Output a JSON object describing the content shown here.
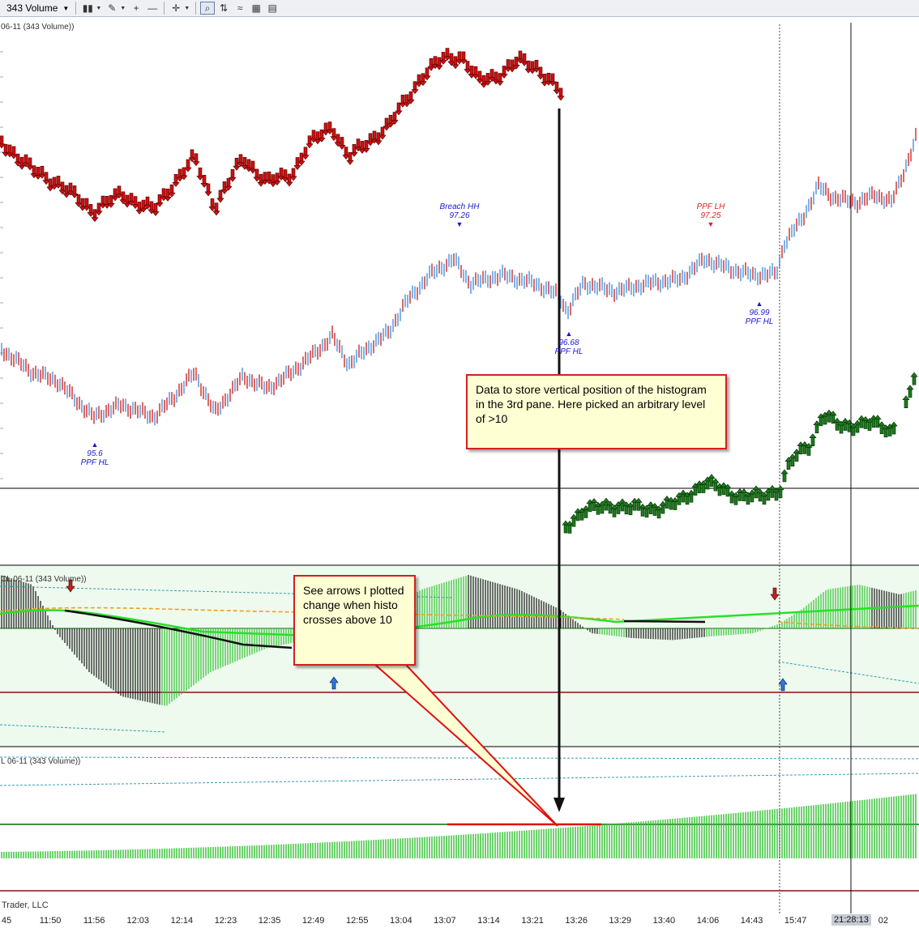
{
  "toolbar": {
    "instrument_select": "343 Volume",
    "buttons": [
      {
        "name": "bar-type-icon",
        "glyph": "▮▮"
      },
      {
        "name": "draw-pencil-icon",
        "glyph": "✎"
      },
      {
        "name": "zoom-in-icon",
        "glyph": "+"
      },
      {
        "name": "zoom-out-icon",
        "glyph": "—"
      },
      {
        "name": "crosshair-icon",
        "glyph": "✛"
      },
      {
        "name": "magnifier-icon",
        "glyph": "⌕"
      },
      {
        "name": "indicators-icon",
        "glyph": "⇅"
      },
      {
        "name": "strategies-icon",
        "glyph": "≈"
      },
      {
        "name": "properties-icon",
        "glyph": "▦"
      },
      {
        "name": "data-box-icon",
        "glyph": "▤"
      }
    ]
  },
  "panes": {
    "price_title": "06-11 (343 Volume))",
    "histo_title": "CL 06-11 (343 Volume))",
    "lower_title": "L 06-11 (343 Volume))"
  },
  "annotations": [
    {
      "id": "breach-hh",
      "line1": "Breach HH",
      "line2": "97.26",
      "color": "#1a1ad0",
      "marker": "down"
    },
    {
      "id": "ppf-lh",
      "line1": "PPF LH",
      "line2": "97.25",
      "color": "#e02020",
      "marker": "down"
    },
    {
      "id": "ppf-hl-1",
      "line1": "95.6",
      "line2": "PPF HL",
      "color": "#1a1ad0",
      "marker": "up"
    },
    {
      "id": "ppf-hl-2",
      "line1": "96.68",
      "line2": "PPF HL",
      "color": "#1a1ad0",
      "marker": "up"
    },
    {
      "id": "ppf-hl-3",
      "line1": "96.99",
      "line2": "PPF HL",
      "color": "#1a1ad0",
      "marker": "up"
    }
  ],
  "callouts": {
    "vertical_position": "Data to store vertical position of the histogram in the 3rd pane.  Here picked an arbitrary level of  >10",
    "arrows_change": "See arrows I plotted change when histo crosses above 10"
  },
  "footer": "Trader, LLC",
  "time_axis": {
    "ticks": [
      "45",
      "11:50",
      "11:56",
      "12:03",
      "12:14",
      "12:23",
      "12:35",
      "12:49",
      "12:55",
      "13:04",
      "13:07",
      "13:14",
      "13:21",
      "13:26",
      "13:29",
      "13:40",
      "14:06",
      "14:43",
      "15:47",
      "18",
      "02"
    ],
    "cursor_time": "21:28:13"
  },
  "colors": {
    "bull_arrow": "#1e7a1e",
    "bear_arrow": "#d01010",
    "candle_up": "#3a8ad8",
    "candle_down": "#c81818",
    "histo_green": "#2fbf2f",
    "histo_black": "#111111",
    "ma_green": "#28e028",
    "ma_orange": "#f0a020",
    "pane_bg": "#eefaee",
    "dark_red_line": "#8a1010"
  }
}
